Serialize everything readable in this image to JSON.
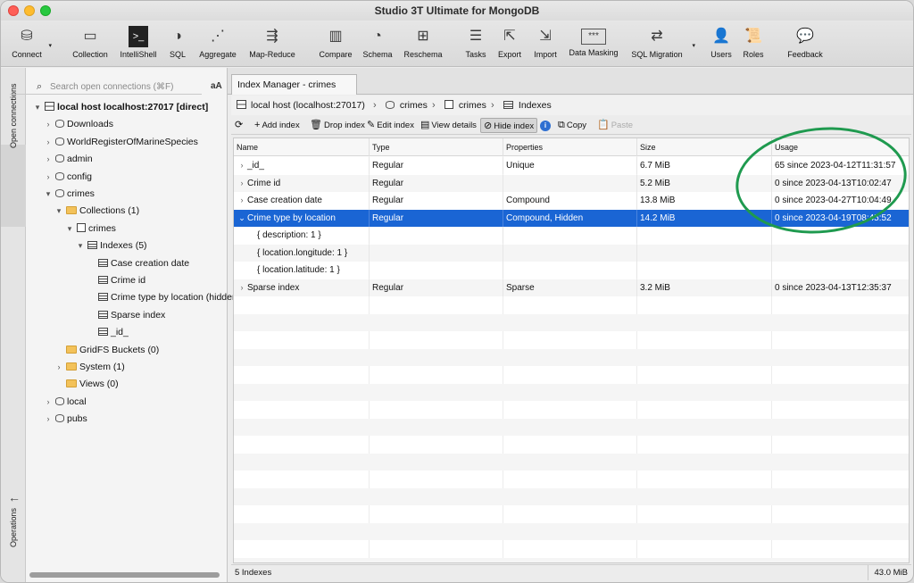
{
  "window": {
    "title": "Studio 3T Ultimate for MongoDB"
  },
  "toolbar": [
    {
      "label": "Connect",
      "icon": "connect-icon"
    },
    {
      "label": "Collection",
      "icon": "collection-icon"
    },
    {
      "label": "IntelliShell",
      "icon": "shell-icon"
    },
    {
      "label": "SQL",
      "icon": "sql-icon"
    },
    {
      "label": "Aggregate",
      "icon": "aggregate-icon"
    },
    {
      "label": "Map-Reduce",
      "icon": "map-reduce-icon"
    },
    {
      "label": "Compare",
      "icon": "compare-icon"
    },
    {
      "label": "Schema",
      "icon": "schema-icon"
    },
    {
      "label": "Reschema",
      "icon": "reschema-icon"
    },
    {
      "label": "Tasks",
      "icon": "tasks-icon"
    },
    {
      "label": "Export",
      "icon": "export-icon"
    },
    {
      "label": "Import",
      "icon": "import-icon"
    },
    {
      "label": "Data Masking",
      "icon": "data-masking-icon"
    },
    {
      "label": "SQL Migration",
      "icon": "sql-migration-icon"
    },
    {
      "label": "Users",
      "icon": "users-icon"
    },
    {
      "label": "Roles",
      "icon": "roles-icon"
    },
    {
      "label": "Feedback",
      "icon": "feedback-icon"
    }
  ],
  "sidetabs": {
    "open_connections": "Open connections",
    "operations": "Operations"
  },
  "search": {
    "placeholder": "Search open connections (⌘F)",
    "case_toggle": "aA"
  },
  "tree": [
    {
      "label": "local host localhost:27017 [direct]",
      "level": 0,
      "chevron": "▾",
      "icon": "server",
      "bold": true
    },
    {
      "label": "Downloads",
      "level": 1,
      "chevron": "›",
      "icon": "db"
    },
    {
      "label": "WorldRegisterOfMarineSpecies",
      "level": 1,
      "chevron": "›",
      "icon": "db"
    },
    {
      "label": "admin",
      "level": 1,
      "chevron": "›",
      "icon": "db"
    },
    {
      "label": "config",
      "level": 1,
      "chevron": "›",
      "icon": "db"
    },
    {
      "label": "crimes",
      "level": 1,
      "chevron": "▾",
      "icon": "db"
    },
    {
      "label": "Collections (1)",
      "level": 2,
      "chevron": "▾",
      "icon": "folder"
    },
    {
      "label": "crimes",
      "level": 3,
      "chevron": "▾",
      "icon": "coll"
    },
    {
      "label": "Indexes (5)",
      "level": 4,
      "chevron": "▾",
      "icon": "grid"
    },
    {
      "label": "Case creation date",
      "level": 5,
      "chevron": "",
      "icon": "grid"
    },
    {
      "label": "Crime id",
      "level": 5,
      "chevron": "",
      "icon": "grid"
    },
    {
      "label": "Crime type by location (hidden",
      "level": 5,
      "chevron": "",
      "icon": "grid"
    },
    {
      "label": "Sparse index",
      "level": 5,
      "chevron": "",
      "icon": "grid"
    },
    {
      "label": "_id_",
      "level": 5,
      "chevron": "",
      "icon": "grid"
    },
    {
      "label": "GridFS Buckets (0)",
      "level": 2,
      "chevron": "",
      "icon": "folder"
    },
    {
      "label": "System (1)",
      "level": 2,
      "chevron": "›",
      "icon": "folder"
    },
    {
      "label": "Views (0)",
      "level": 2,
      "chevron": "",
      "icon": "folder"
    },
    {
      "label": "local",
      "level": 1,
      "chevron": "›",
      "icon": "db"
    },
    {
      "label": "pubs",
      "level": 1,
      "chevron": "›",
      "icon": "db"
    }
  ],
  "tab": {
    "label": "Index Manager - crimes"
  },
  "breadcrumb": {
    "server": "local host (localhost:27017)",
    "db": "crimes",
    "collection": "crimes",
    "section": "Indexes"
  },
  "actions": {
    "add": "Add index",
    "drop": "Drop index",
    "edit": "Edit index",
    "view": "View details",
    "hide": "Hide index",
    "info": "i",
    "copy": "Copy",
    "paste": "Paste"
  },
  "table": {
    "columns": [
      "Name",
      "Type",
      "Properties",
      "Size",
      "Usage"
    ],
    "rows": [
      {
        "chev": "›",
        "name": "_id_",
        "type": "Regular",
        "props": "Unique",
        "size": "6.7 MiB",
        "usage": "65 since 2023-04-12T11:31:57"
      },
      {
        "chev": "›",
        "name": "Crime id",
        "type": "Regular",
        "props": "",
        "size": "5.2 MiB",
        "usage": "0 since 2023-04-13T10:02:47"
      },
      {
        "chev": "›",
        "name": "Case creation date",
        "type": "Regular",
        "props": "Compound",
        "size": "13.8 MiB",
        "usage": "0 since 2023-04-27T10:04:49"
      },
      {
        "chev": "⌄",
        "name": "Crime type by location",
        "type": "Regular",
        "props": "Compound, Hidden",
        "size": "14.2 MiB",
        "usage": "0 since 2023-04-19T08:45:52",
        "selected": true
      },
      {
        "chev": "",
        "name": "{ description: 1 }",
        "type": "",
        "props": "",
        "size": "",
        "usage": "",
        "sub": true
      },
      {
        "chev": "",
        "name": "{ location.longitude: 1 }",
        "type": "",
        "props": "",
        "size": "",
        "usage": "",
        "sub": true
      },
      {
        "chev": "",
        "name": "{ location.latitude: 1 }",
        "type": "",
        "props": "",
        "size": "",
        "usage": "",
        "sub": true
      },
      {
        "chev": "›",
        "name": "Sparse index",
        "type": "Regular",
        "props": "Sparse",
        "size": "3.2 MiB",
        "usage": "0 since 2023-04-13T12:35:37"
      }
    ]
  },
  "status": {
    "count": "5 Indexes",
    "total": "43.0 MiB"
  },
  "colors": {
    "selection": "#1a65d4",
    "annotation": "#1f9a4f"
  }
}
